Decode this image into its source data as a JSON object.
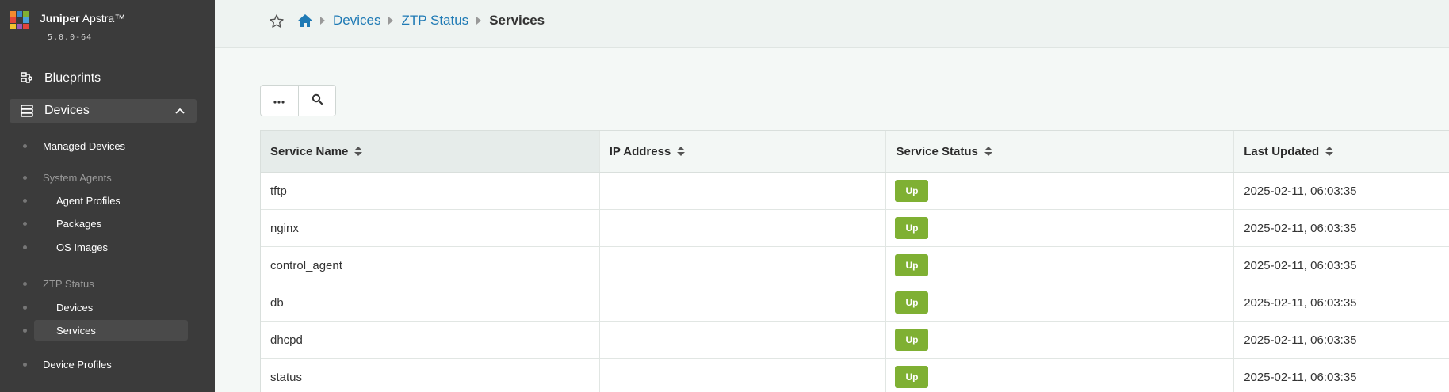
{
  "app": {
    "brand_bold": "Juniper",
    "brand_rest": " Apstra™",
    "version": "5.0.0-64",
    "logo_colors": [
      "#f28b30",
      "#3a86c8",
      "#7fb033",
      "#e2463b",
      "#3b3b3b",
      "#4aa0d8",
      "#f2c230",
      "#9b59b6",
      "#e2463b"
    ]
  },
  "sidebar": {
    "blueprints_label": "Blueprints",
    "devices_label": "Devices",
    "sub": {
      "managed_devices": "Managed Devices",
      "system_agents": "System Agents",
      "agent_profiles": "Agent Profiles",
      "packages": "Packages",
      "os_images": "OS Images",
      "ztp_status": "ZTP Status",
      "ztp_devices": "Devices",
      "ztp_services": "Services",
      "device_profiles": "Device Profiles"
    }
  },
  "breadcrumb": {
    "items": [
      "Devices",
      "ZTP Status"
    ],
    "current": "Services"
  },
  "table": {
    "headers": [
      "Service Name",
      "IP Address",
      "Service Status",
      "Last Updated"
    ],
    "rows": [
      {
        "name": "tftp",
        "ip": "",
        "status": "Up",
        "updated": "2025-02-11, 06:03:35"
      },
      {
        "name": "nginx",
        "ip": "",
        "status": "Up",
        "updated": "2025-02-11, 06:03:35"
      },
      {
        "name": "control_agent",
        "ip": "",
        "status": "Up",
        "updated": "2025-02-11, 06:03:35"
      },
      {
        "name": "db",
        "ip": "",
        "status": "Up",
        "updated": "2025-02-11, 06:03:35"
      },
      {
        "name": "dhcpd",
        "ip": "",
        "status": "Up",
        "updated": "2025-02-11, 06:03:35"
      },
      {
        "name": "status",
        "ip": "",
        "status": "Up",
        "updated": "2025-02-11, 06:03:35"
      }
    ]
  },
  "colors": {
    "status_up": "#7fb033",
    "link": "#1f7ab5",
    "sidebar_bg": "#3b3b3b"
  }
}
